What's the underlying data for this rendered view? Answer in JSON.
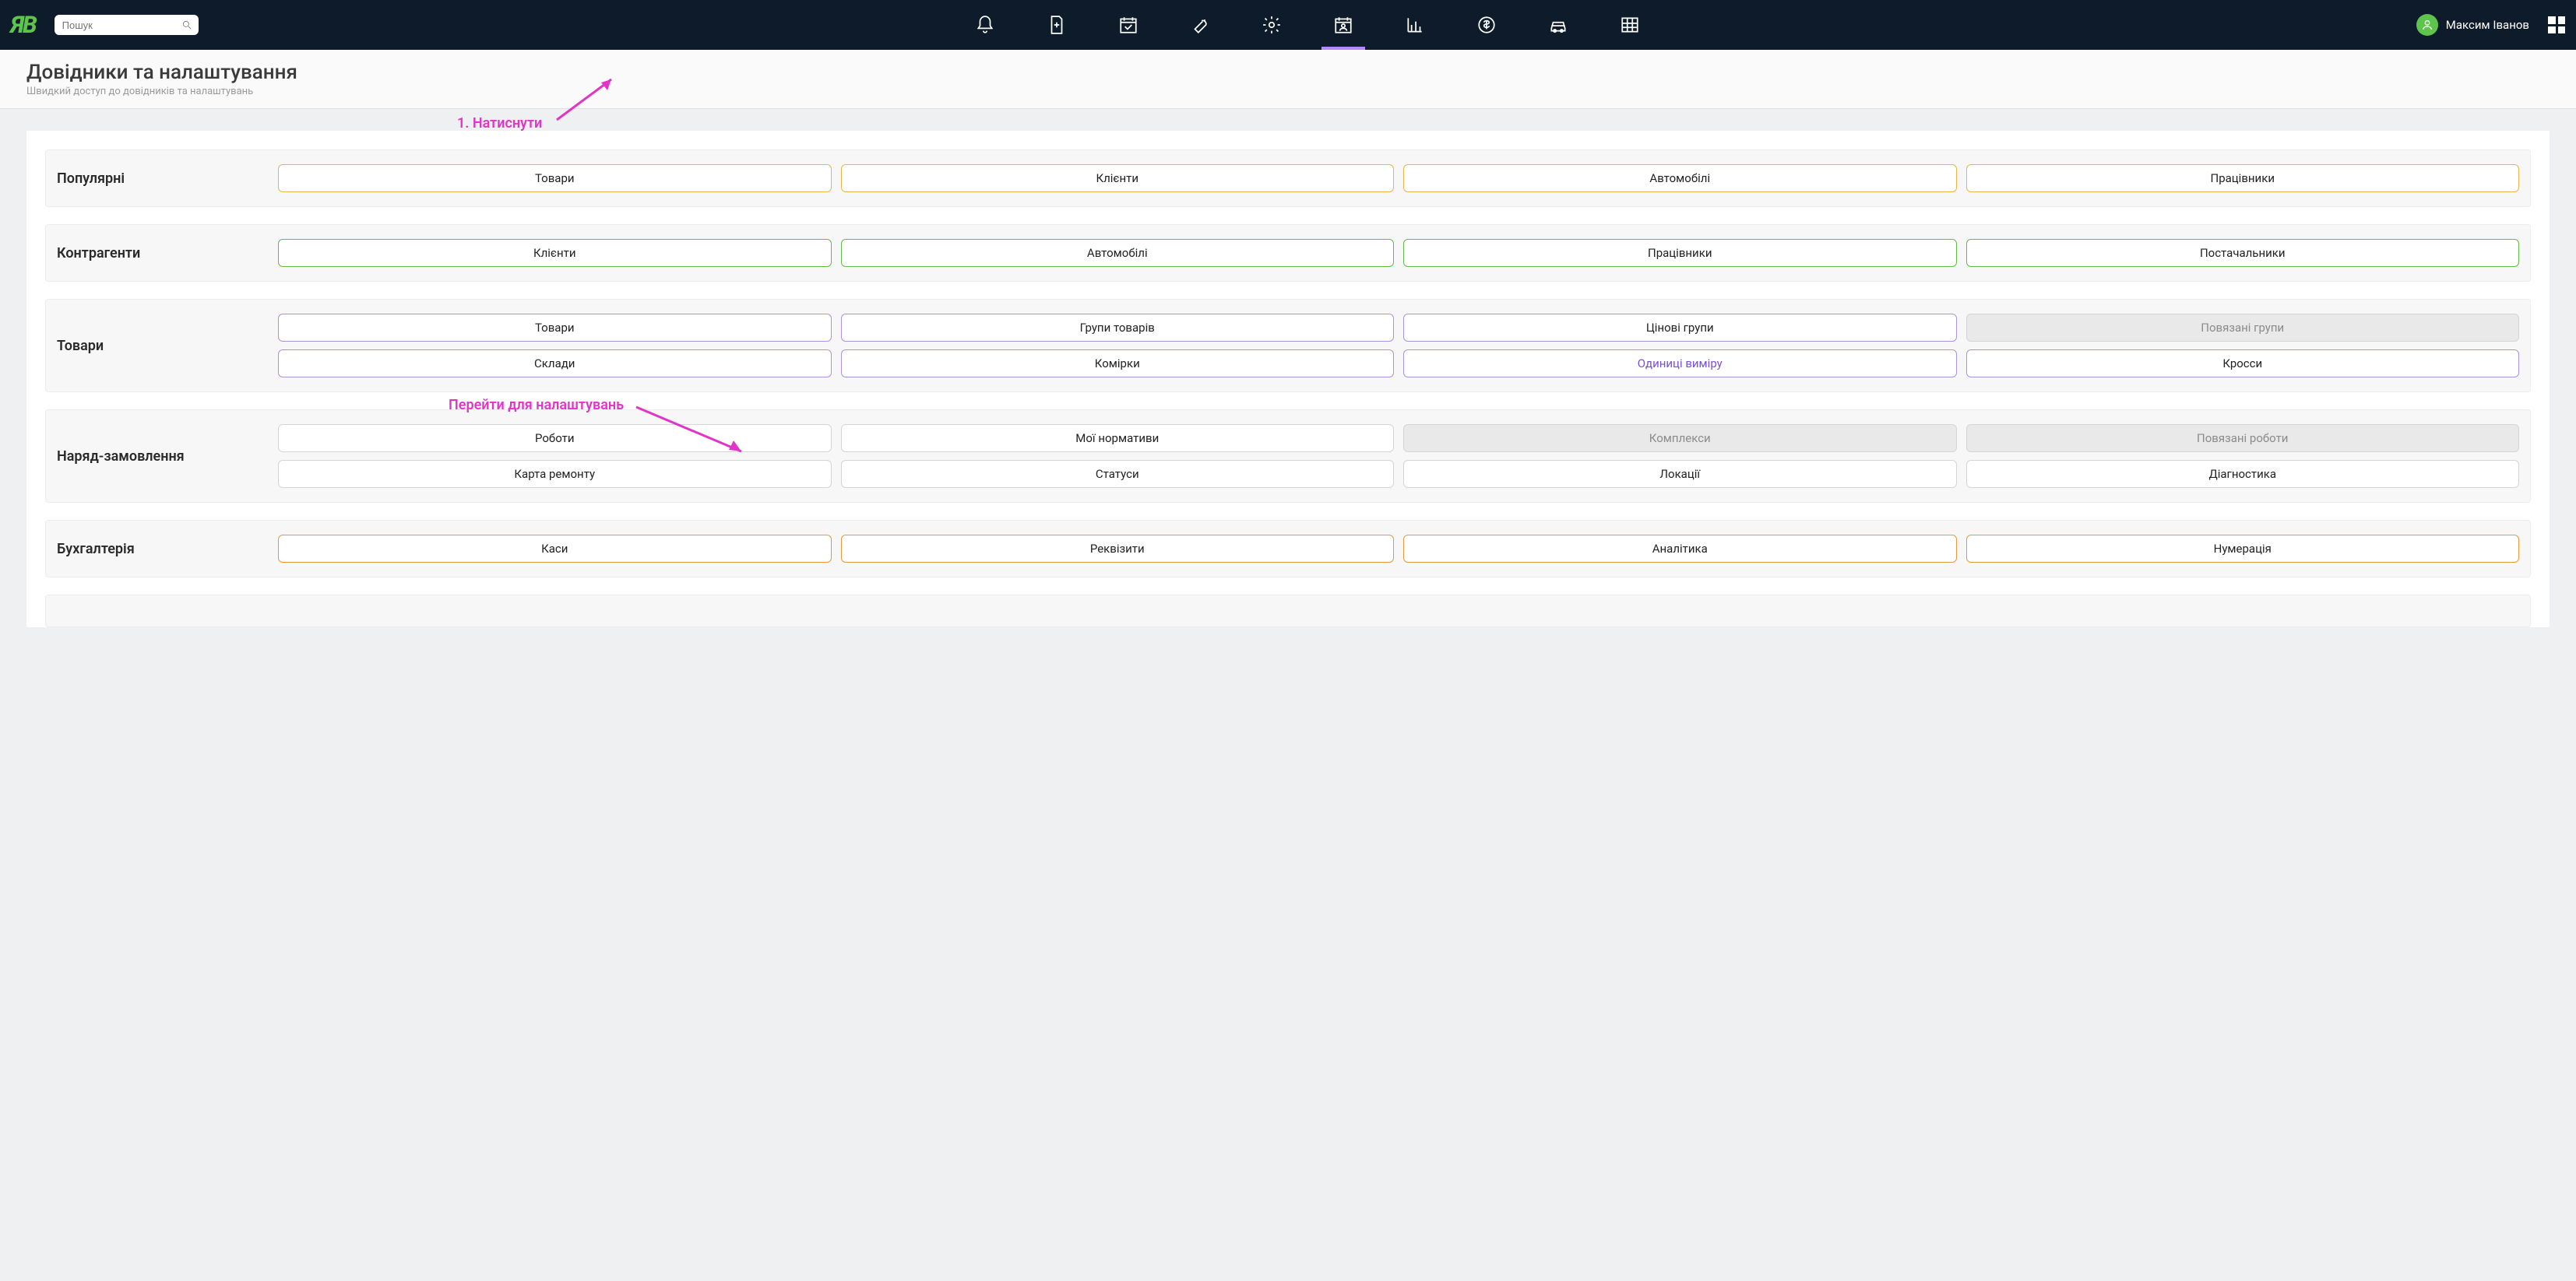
{
  "header": {
    "logo_text": "ЯB",
    "search_placeholder": "Пошук",
    "user_name": "Максим Іванов"
  },
  "page": {
    "title": "Довідники та налаштування",
    "subtitle": "Швидкий доступ до довідників та налаштувань"
  },
  "annotations": {
    "a1": "1. Натиснути",
    "a2": "Перейти для налаштувань"
  },
  "sections": [
    {
      "label": "Популярні",
      "style": "b-yellow",
      "rows": 1,
      "buttons": [
        {
          "label": "Товари"
        },
        {
          "label": "Клієнти"
        },
        {
          "label": "Автомобілі"
        },
        {
          "label": "Працівники"
        }
      ]
    },
    {
      "label": "Контрагенти",
      "style": "b-green",
      "rows": 1,
      "buttons": [
        {
          "label": "Клієнти"
        },
        {
          "label": "Автомобілі"
        },
        {
          "label": "Працівники"
        },
        {
          "label": "Постачальники"
        }
      ]
    },
    {
      "label": "Товари",
      "style": "b-purple",
      "rows": 2,
      "buttons": [
        {
          "label": "Товари"
        },
        {
          "label": "Групи товарів"
        },
        {
          "label": "Цінові групи"
        },
        {
          "label": "Повязані групи",
          "disabled": true
        },
        {
          "label": "Склади"
        },
        {
          "label": "Комірки"
        },
        {
          "label": "Одиниці виміру",
          "highlight": true
        },
        {
          "label": "Кросси"
        }
      ]
    },
    {
      "label": "Наряд-замовлення",
      "style": "b-gray",
      "rows": 2,
      "buttons": [
        {
          "label": "Роботи"
        },
        {
          "label": "Мої нормативи"
        },
        {
          "label": "Комплекси",
          "disabled": true
        },
        {
          "label": "Повязані роботи",
          "disabled": true
        },
        {
          "label": "Карта ремонту"
        },
        {
          "label": "Статуси"
        },
        {
          "label": "Локації"
        },
        {
          "label": "Діагностика"
        }
      ]
    },
    {
      "label": "Бухгалтерія",
      "style": "b-orange",
      "rows": 1,
      "buttons": [
        {
          "label": "Каси"
        },
        {
          "label": "Реквізити"
        },
        {
          "label": "Аналітика"
        },
        {
          "label": "Нумерація"
        }
      ]
    }
  ]
}
